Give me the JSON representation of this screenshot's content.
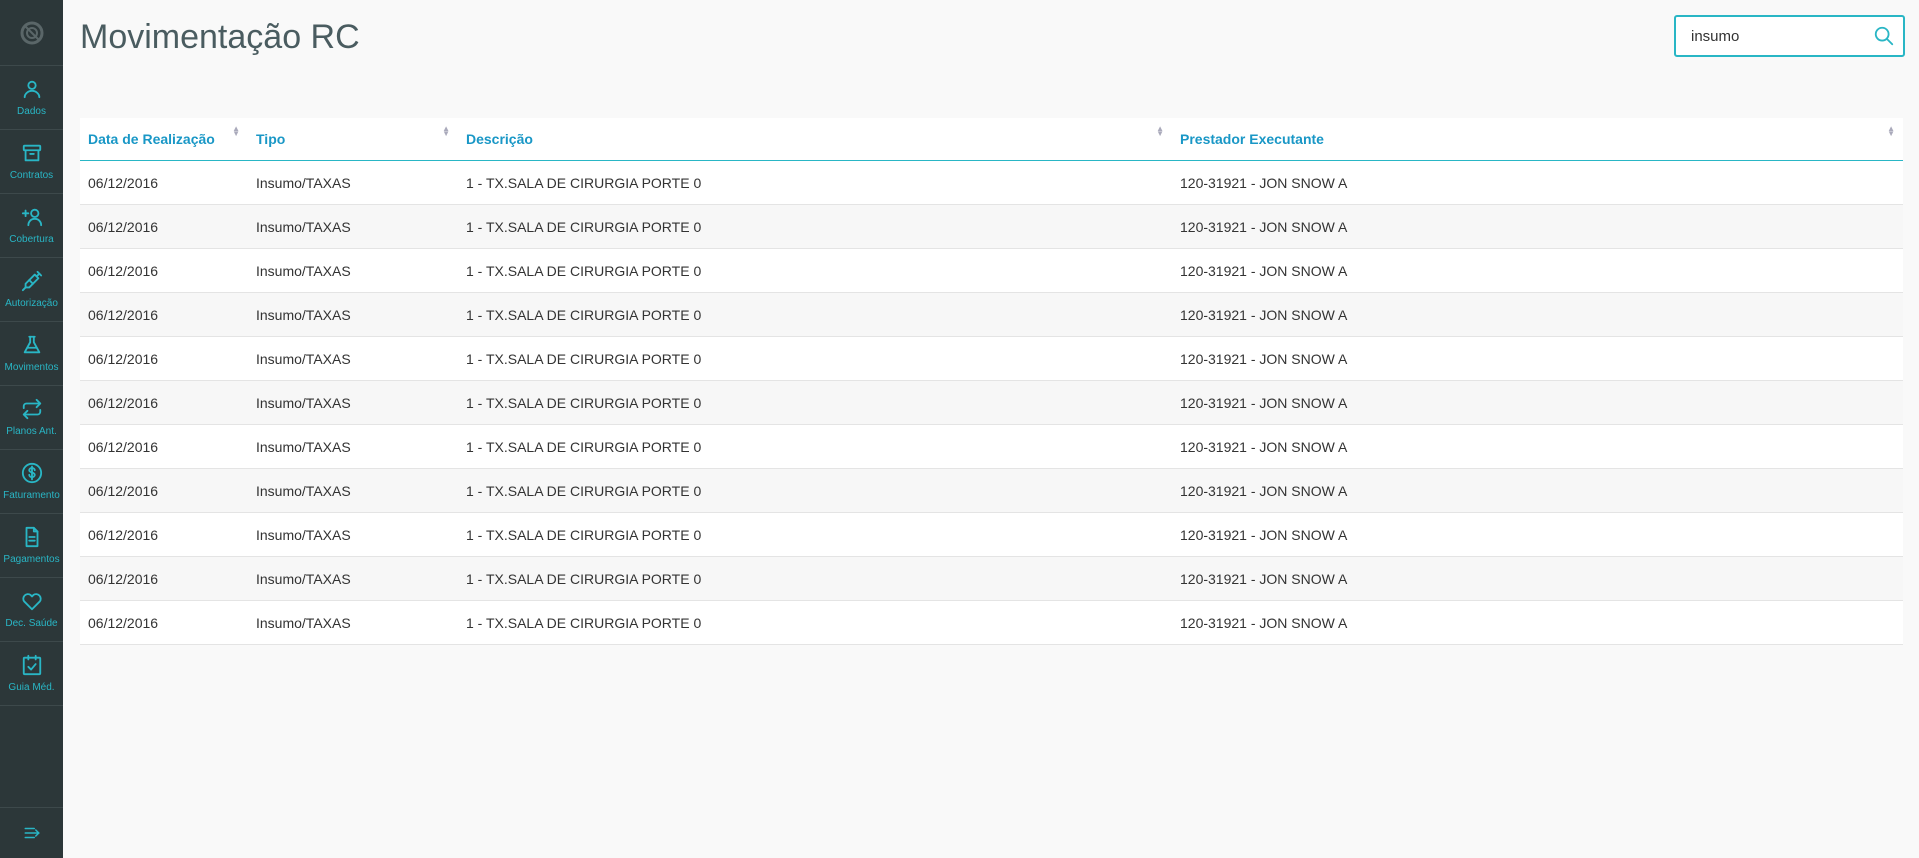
{
  "page": {
    "title": "Movimentação RC"
  },
  "search": {
    "value": "insumo"
  },
  "sidebar": {
    "items": [
      {
        "label": "Dados",
        "icon": "user-icon"
      },
      {
        "label": "Contratos",
        "icon": "archive-icon"
      },
      {
        "label": "Cobertura",
        "icon": "add-user-icon"
      },
      {
        "label": "Autorização",
        "icon": "syringe-icon"
      },
      {
        "label": "Movimentos",
        "icon": "flask-icon"
      },
      {
        "label": "Planos Ant.",
        "icon": "exchange-icon"
      },
      {
        "label": "Faturamento",
        "icon": "dollar-icon"
      },
      {
        "label": "Pagamentos",
        "icon": "document-icon"
      },
      {
        "label": "Dec. Saúde",
        "icon": "heart-icon"
      },
      {
        "label": "Guia Méd.",
        "icon": "calendar-check-icon"
      }
    ]
  },
  "table": {
    "headers": [
      "Data de Realização",
      "Tipo",
      "Descrição",
      "Prestador Executante"
    ],
    "rows": [
      [
        "06/12/2016",
        "Insumo/TAXAS",
        "1 - TX.SALA DE CIRURGIA PORTE 0",
        "120-31921 - JON SNOW A"
      ],
      [
        "06/12/2016",
        "Insumo/TAXAS",
        "1 - TX.SALA DE CIRURGIA PORTE 0",
        "120-31921 - JON SNOW A"
      ],
      [
        "06/12/2016",
        "Insumo/TAXAS",
        "1 - TX.SALA DE CIRURGIA PORTE 0",
        "120-31921 - JON SNOW A"
      ],
      [
        "06/12/2016",
        "Insumo/TAXAS",
        "1 - TX.SALA DE CIRURGIA PORTE 0",
        "120-31921 - JON SNOW A"
      ],
      [
        "06/12/2016",
        "Insumo/TAXAS",
        "1 - TX.SALA DE CIRURGIA PORTE 0",
        "120-31921 - JON SNOW A"
      ],
      [
        "06/12/2016",
        "Insumo/TAXAS",
        "1 - TX.SALA DE CIRURGIA PORTE 0",
        "120-31921 - JON SNOW A"
      ],
      [
        "06/12/2016",
        "Insumo/TAXAS",
        "1 - TX.SALA DE CIRURGIA PORTE 0",
        "120-31921 - JON SNOW A"
      ],
      [
        "06/12/2016",
        "Insumo/TAXAS",
        "1 - TX.SALA DE CIRURGIA PORTE 0",
        "120-31921 - JON SNOW A"
      ],
      [
        "06/12/2016",
        "Insumo/TAXAS",
        "1 - TX.SALA DE CIRURGIA PORTE 0",
        "120-31921 - JON SNOW A"
      ],
      [
        "06/12/2016",
        "Insumo/TAXAS",
        "1 - TX.SALA DE CIRURGIA PORTE 0",
        "120-31921 - JON SNOW A"
      ],
      [
        "06/12/2016",
        "Insumo/TAXAS",
        "1 - TX.SALA DE CIRURGIA PORTE 0",
        "120-31921 - JON SNOW A"
      ]
    ]
  },
  "colors": {
    "sidebar_bg": "#2c3739",
    "accent": "#29b6c5",
    "header_text": "#1997c6",
    "title_text": "#4a5c60"
  }
}
